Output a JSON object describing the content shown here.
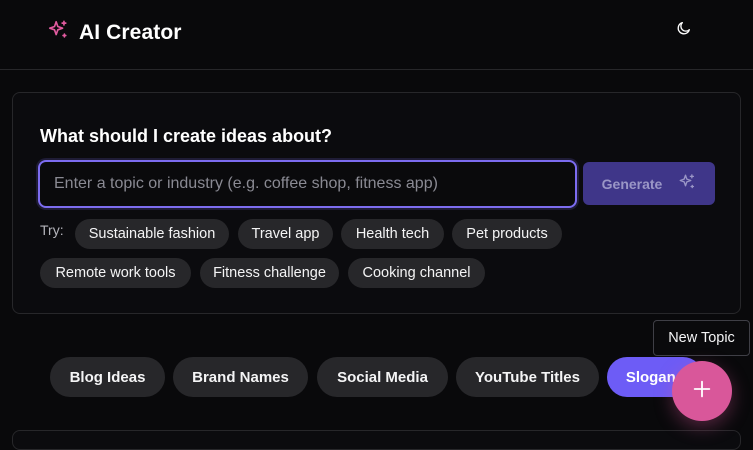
{
  "app": {
    "title": "AI Creator"
  },
  "header": {
    "theme_toggle_icon": "moon-icon",
    "brand_icon": "sparkles-icon"
  },
  "colors": {
    "accent": "#6d5cf6",
    "brand_pink": "#e15b9f",
    "fab": "#d9579a"
  },
  "prompt": {
    "heading": "What should I create ideas about?",
    "placeholder": "Enter a topic or industry (e.g. coffee shop, fitness app)",
    "value": "",
    "generate_label": "Generate",
    "generate_icon": "sparkles-icon"
  },
  "suggestions": {
    "label": "Try:",
    "items": [
      "Sustainable fashion",
      "Travel app",
      "Health tech",
      "Pet products",
      "Remote work tools",
      "Fitness challenge",
      "Cooking channel"
    ]
  },
  "categories": {
    "items": [
      "Blog Ideas",
      "Brand Names",
      "Social Media",
      "YouTube Titles",
      "Slogans"
    ],
    "active": "Slogans"
  },
  "fab": {
    "tooltip": "New Topic",
    "icon": "plus-icon"
  }
}
